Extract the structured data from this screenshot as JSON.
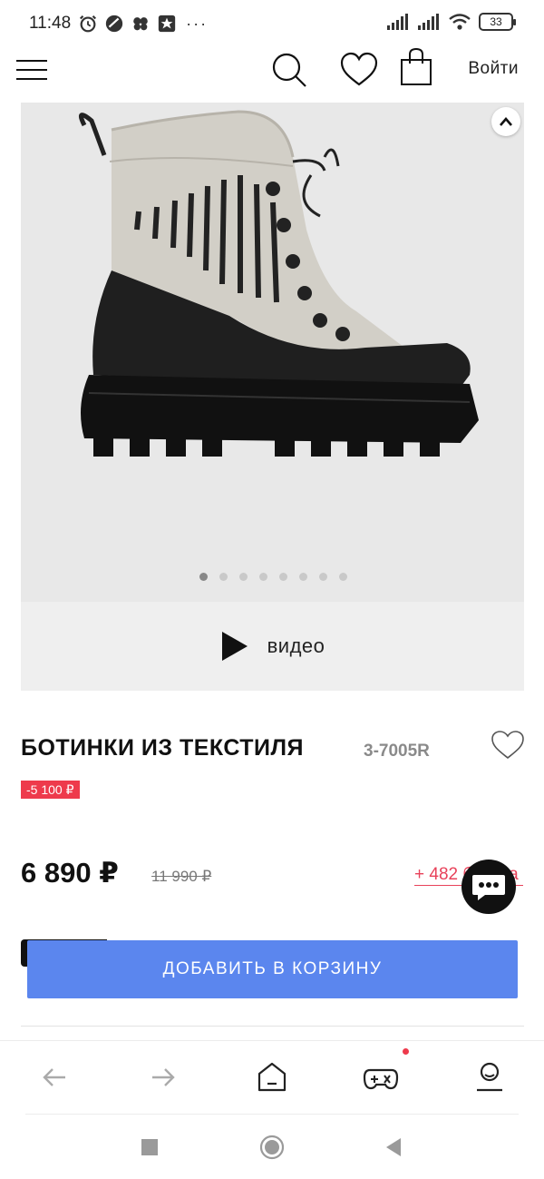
{
  "status_bar": {
    "time": "11:48",
    "more": "···",
    "battery": "33",
    "app_icons": [
      "alarm-icon",
      "app-icon",
      "flower-icon",
      "star-app-icon"
    ]
  },
  "header": {
    "login_label": "Войти",
    "icons": [
      "menu-icon",
      "search-icon",
      "heart-icon",
      "bag-icon"
    ]
  },
  "gallery": {
    "image": "black-and-beige-lace-up-boot",
    "slides": 8,
    "active_slide": 1,
    "video_label": "видео"
  },
  "product": {
    "title": "БОТИНКИ ИЗ ТЕКСТИЛЯ",
    "sku": "3-7005R",
    "discount": "-5 100 ₽",
    "price": "6 890 ₽",
    "old_price": "11 990 ₽",
    "bonus": "+ 482 бонуса",
    "add_to_cart": "ДОБАВИТЬ В КОРЗИНУ"
  },
  "colors": {
    "accent_button": "#5b86ee",
    "discount_red": "#ee3a4c",
    "bonus_red": "#e8425a"
  },
  "browser_nav": [
    "back-icon",
    "forward-icon",
    "home-icon",
    "games-icon",
    "profile-icon"
  ],
  "system_nav": [
    "recent-apps-icon",
    "home-circle-icon",
    "back-triangle-icon"
  ]
}
